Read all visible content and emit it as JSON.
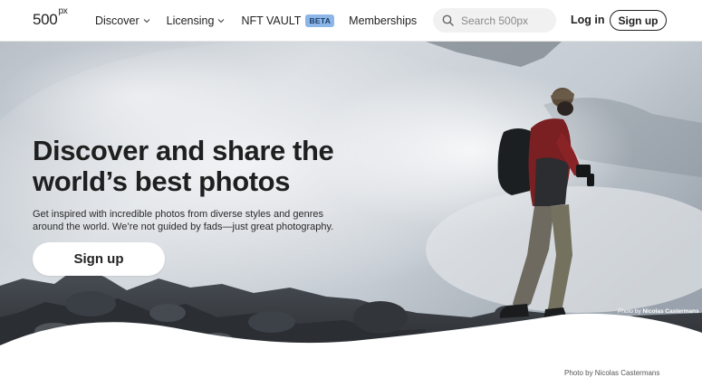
{
  "header": {
    "logo": "500",
    "logo_sup": "px",
    "nav": {
      "discover": "Discover",
      "licensing": "Licensing",
      "nft_vault": "NFT VAULT",
      "nft_badge": "BETA",
      "memberships": "Memberships"
    },
    "search": {
      "placeholder": "Search 500px",
      "value": ""
    },
    "login": "Log in",
    "signup": "Sign up"
  },
  "hero": {
    "headline_line1": "Discover and share the",
    "headline_line2": "world’s best photos",
    "subtext_line1": "Get inspired with incredible photos from diverse styles and genres",
    "subtext_line2": "around the world. We’re not guided by fads—just great photography.",
    "signup": "Sign up",
    "credit_overlay_prefix": "Photo by ",
    "credit_overlay_name": "Nicolas Castermans",
    "credit_bottom": "Photo by Nicolas Castermans"
  },
  "icons": {
    "search": "search-icon",
    "chevron": "chevron-down-icon"
  },
  "colors": {
    "badge_bg": "#8cb6e8",
    "text": "#222222",
    "hero_sky": "#c9cfd6"
  }
}
